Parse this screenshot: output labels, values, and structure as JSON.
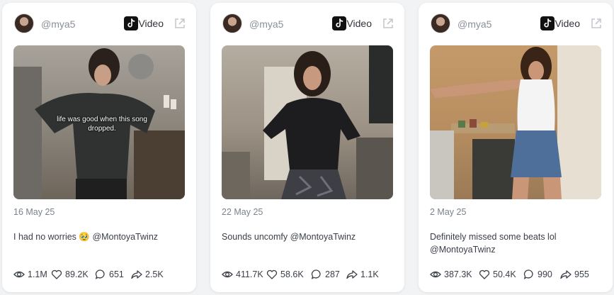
{
  "cards": [
    {
      "handle": "@mya5",
      "platform_label": "Video",
      "caption_overlay": "life was good when this song dropped.",
      "date": "16 May 25",
      "description": "I had no worries 🥹 @MontoyaTwinz",
      "stats": {
        "views": "1.1M",
        "likes": "89.2K",
        "comments": "651",
        "shares": "2.5K"
      }
    },
    {
      "handle": "@mya5",
      "platform_label": "Video",
      "date": "22 May 25",
      "description": "Sounds uncomfy @MontoyaTwinz",
      "stats": {
        "views": "411.7K",
        "likes": "58.6K",
        "comments": "287",
        "shares": "1.1K"
      }
    },
    {
      "handle": "@mya5",
      "platform_label": "Video",
      "date": "2 May 25",
      "description": "Definitely missed some beats lol @MontoyaTwinz",
      "stats": {
        "views": "387.3K",
        "likes": "50.4K",
        "comments": "990",
        "shares": "955"
      }
    }
  ],
  "icons": {
    "platform": "tiktok-icon",
    "external": "external-link-icon",
    "views": "eye-icon",
    "likes": "heart-icon",
    "comments": "comment-icon",
    "shares": "share-icon"
  },
  "colors": {
    "page_bg": "#f2f3f5",
    "card_bg": "#ffffff",
    "muted_text": "#7c828c",
    "body_text": "#3a3f47"
  }
}
